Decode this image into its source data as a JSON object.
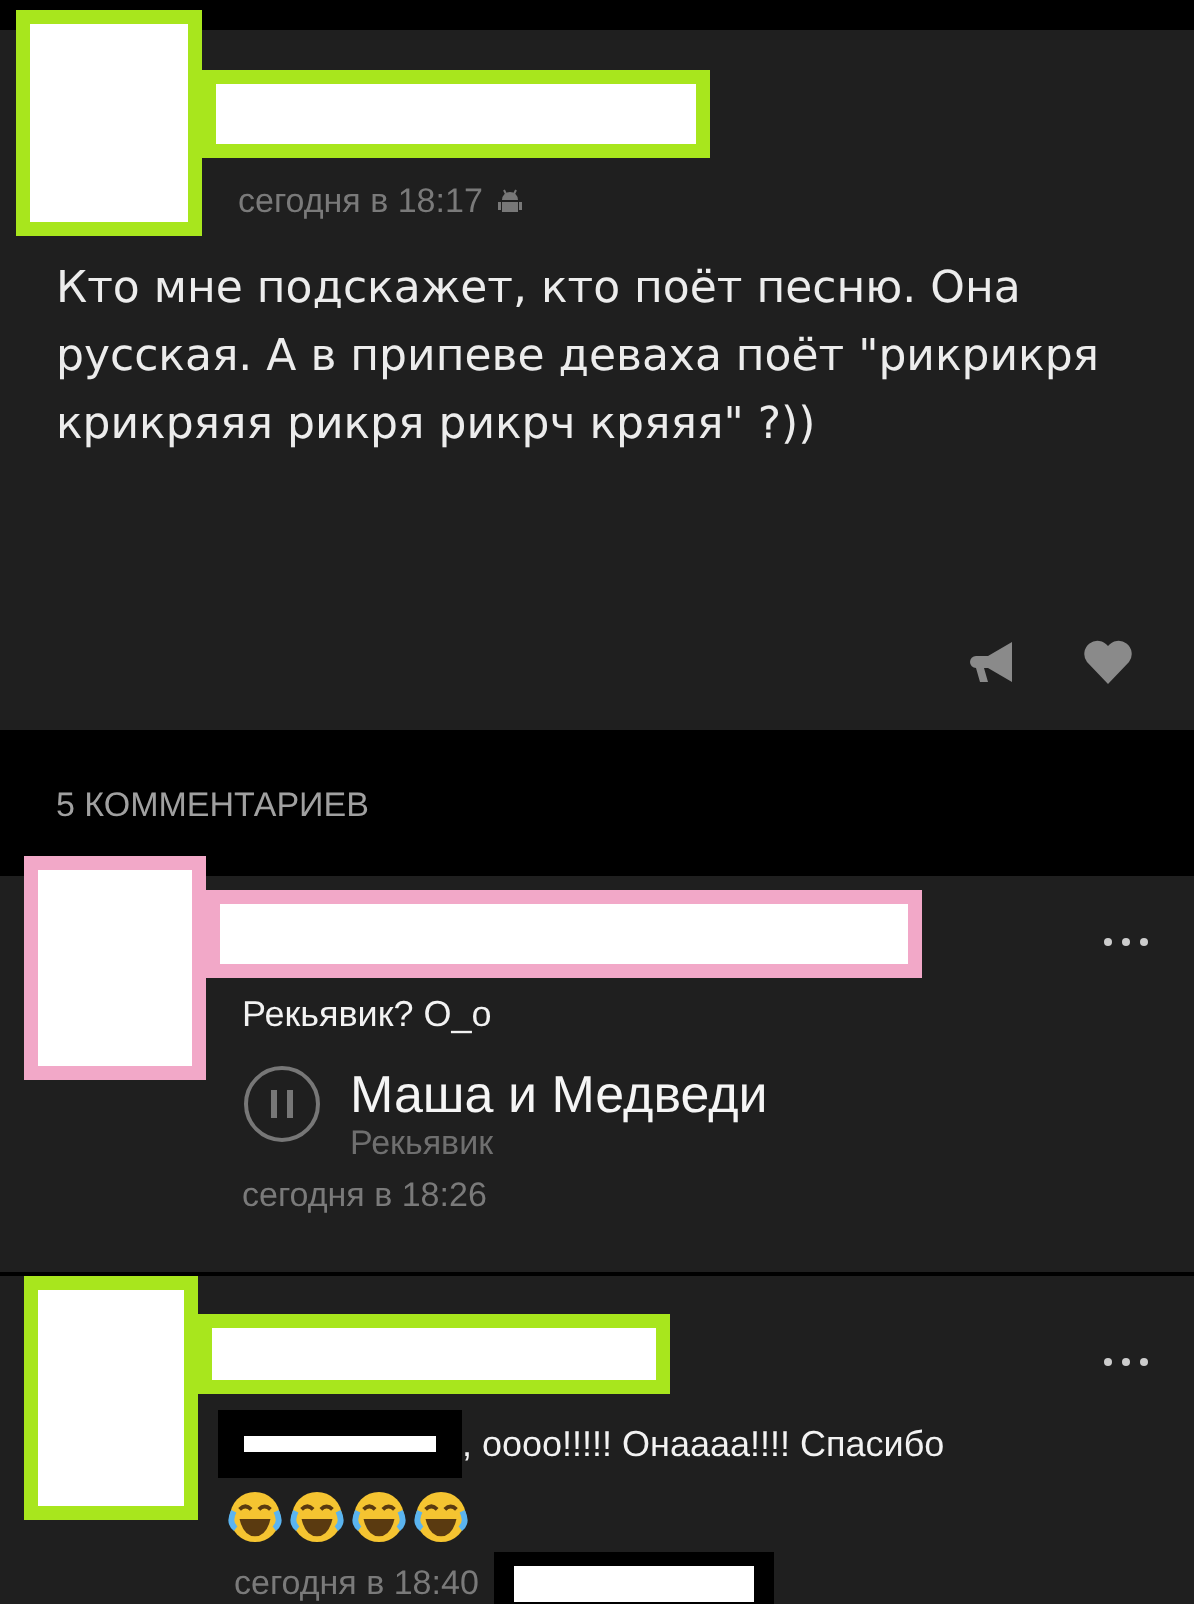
{
  "post": {
    "color": "#a8e61d",
    "time": "сегодня в 18:17",
    "text": "Кто мне подскажет, кто поёт песню. Она русская. А в припеве деваха поёт \"рикрикря крикряяя рикря рикрч кряяя\" ?))"
  },
  "comments_header": "5 КОММЕНТАРИЕВ",
  "comments": [
    {
      "color": "#f2a8c8",
      "mention_hidden": false,
      "text": "Рекьявик? О_о",
      "audio": {
        "title": "Маша и Медведи",
        "artist": "Рекьявик",
        "playing": true
      },
      "time": "сегодня в 18:26",
      "time_tail_hidden": false
    },
    {
      "color": "#a8e61d",
      "mention_hidden": true,
      "text": ", оооо!!!!! Онаааа!!!! Спасибо",
      "emojis": [
        {
          "kind": "laughing-tears"
        },
        {
          "kind": "laughing-tears"
        },
        {
          "kind": "laughing-tears"
        },
        {
          "kind": "laughing-tears"
        }
      ],
      "time": "сегодня в 18:40",
      "time_tail_hidden": true
    }
  ]
}
